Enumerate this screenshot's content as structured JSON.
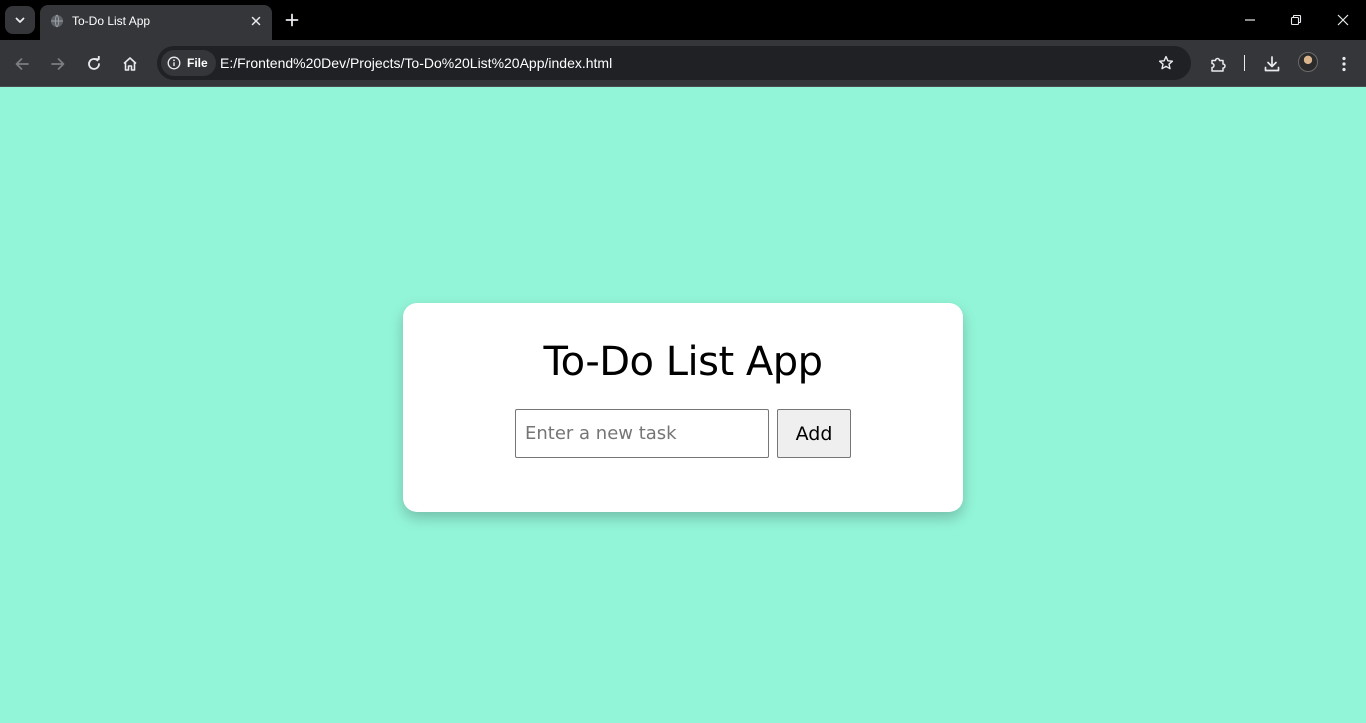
{
  "browser": {
    "tab": {
      "title": "To-Do List App"
    },
    "address": {
      "chip_label": "File",
      "url": "E:/Frontend%20Dev/Projects/To-Do%20List%20App/index.html"
    }
  },
  "app": {
    "title": "To-Do List App",
    "task_input": {
      "placeholder": "Enter a new task",
      "value": ""
    },
    "add_label": "Add"
  },
  "colors": {
    "page_background": "#93f5d8",
    "card_background": "#ffffff",
    "chrome_dark": "#35363a"
  },
  "icons": {
    "tab_search": "chevron-down-icon",
    "favicon": "globe-icon",
    "tab_close": "close-icon",
    "new_tab": "plus-icon",
    "back": "back-arrow-icon",
    "forward": "forward-arrow-icon",
    "reload": "reload-icon",
    "home": "home-icon",
    "site_info": "info-icon",
    "bookmark": "star-icon",
    "extensions": "puzzle-icon",
    "downloads": "download-icon",
    "menu": "kebab-menu-icon"
  }
}
